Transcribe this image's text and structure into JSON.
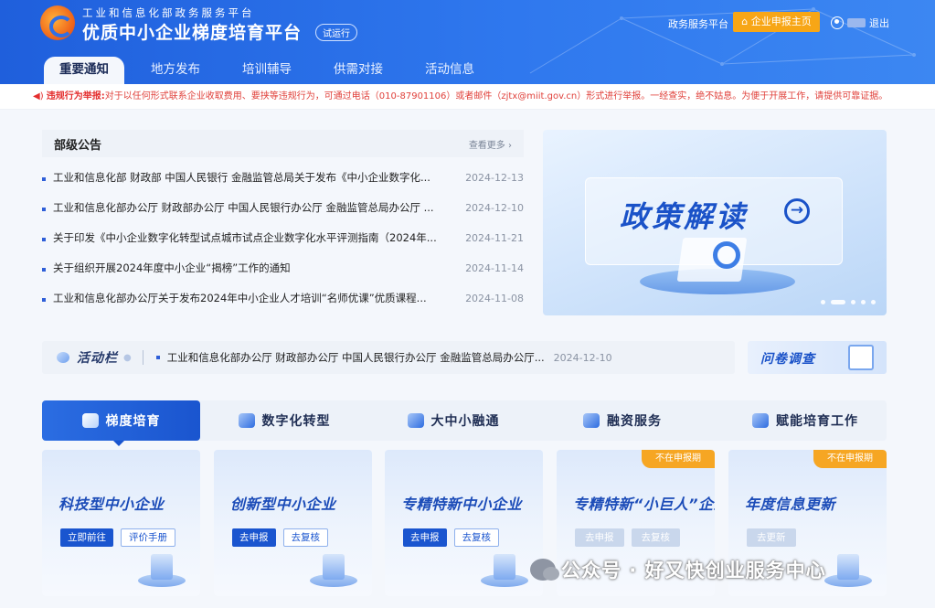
{
  "header": {
    "subtitle": "工业和信息化部政务服务平台",
    "title": "优质中小企业梯度培育平台",
    "trial_badge": "试运行",
    "gov_link": "政务服务平台",
    "apply_button": "企业申报主页",
    "logout": "退出"
  },
  "nav": {
    "tabs": [
      {
        "label": "重要通知",
        "active": true
      },
      {
        "label": "地方发布"
      },
      {
        "label": "培训辅导"
      },
      {
        "label": "供需对接"
      },
      {
        "label": "活动信息"
      }
    ]
  },
  "notice": {
    "label": "违规行为举报:",
    "text": "对于以任何形式联系企业收取费用、要挟等违规行为，可通过电话（010-87901106）或者邮件（zjtx@miit.gov.cn）形式进行举报。一经查实，绝不姑息。为便于开展工作，请提供可靠证据。"
  },
  "announcements": {
    "title": "部级公告",
    "more": "查看更多 ›",
    "items": [
      {
        "title": "工业和信息化部 财政部 中国人民银行 金融监管总局关于发布《中小企业数字化...",
        "date": "2024-12-13"
      },
      {
        "title": "工业和信息化部办公厅 财政部办公厅 中国人民银行办公厅 金融监管总局办公厅 ...",
        "date": "2024-12-10"
      },
      {
        "title": "关于印发《中小企业数字化转型试点城市试点企业数字化水平评测指南（2024年...",
        "date": "2024-11-21"
      },
      {
        "title": "关于组织开展2024年度中小企业“揭榜”工作的通知",
        "date": "2024-11-14"
      },
      {
        "title": "工业和信息化部办公厅关于发布2024年中小企业人才培训“名师优课”优质课程...",
        "date": "2024-11-08"
      }
    ]
  },
  "banner": {
    "text": "政策解读",
    "slide_count": 6,
    "active_slide": 2
  },
  "activity": {
    "label": "活动栏",
    "text": "工业和信息化部办公厅 财政部办公厅 中国人民银行办公厅 金融监管总局办公厅...",
    "date": "2024-12-10"
  },
  "survey": {
    "label": "问卷调查"
  },
  "categories": [
    {
      "label": "梯度培育",
      "active": true
    },
    {
      "label": "数字化转型"
    },
    {
      "label": "大中小融通"
    },
    {
      "label": "融资服务"
    },
    {
      "label": "赋能培育工作"
    }
  ],
  "cards": [
    {
      "title": "科技型中小企业",
      "btn1": "立即前往",
      "btn2": "评价手册"
    },
    {
      "title": "创新型中小企业",
      "btn1": "去申报",
      "btn2": "去复核"
    },
    {
      "title": "专精特新中小企业",
      "btn1": "去申报",
      "btn2": "去复核"
    },
    {
      "title": "专精特新“小巨人”企业",
      "btn1": "去申报",
      "btn2": "去复核",
      "badge": "不在申报期"
    },
    {
      "title": "年度信息更新",
      "btn1": "去更新",
      "badge": "不在申报期"
    }
  ],
  "watermark": "公众号 · 好又快创业服务中心",
  "colors": {
    "primary": "#1a55cf",
    "header": "#2f78ee",
    "badge": "#f6a623",
    "alert": "#e42d2d"
  }
}
